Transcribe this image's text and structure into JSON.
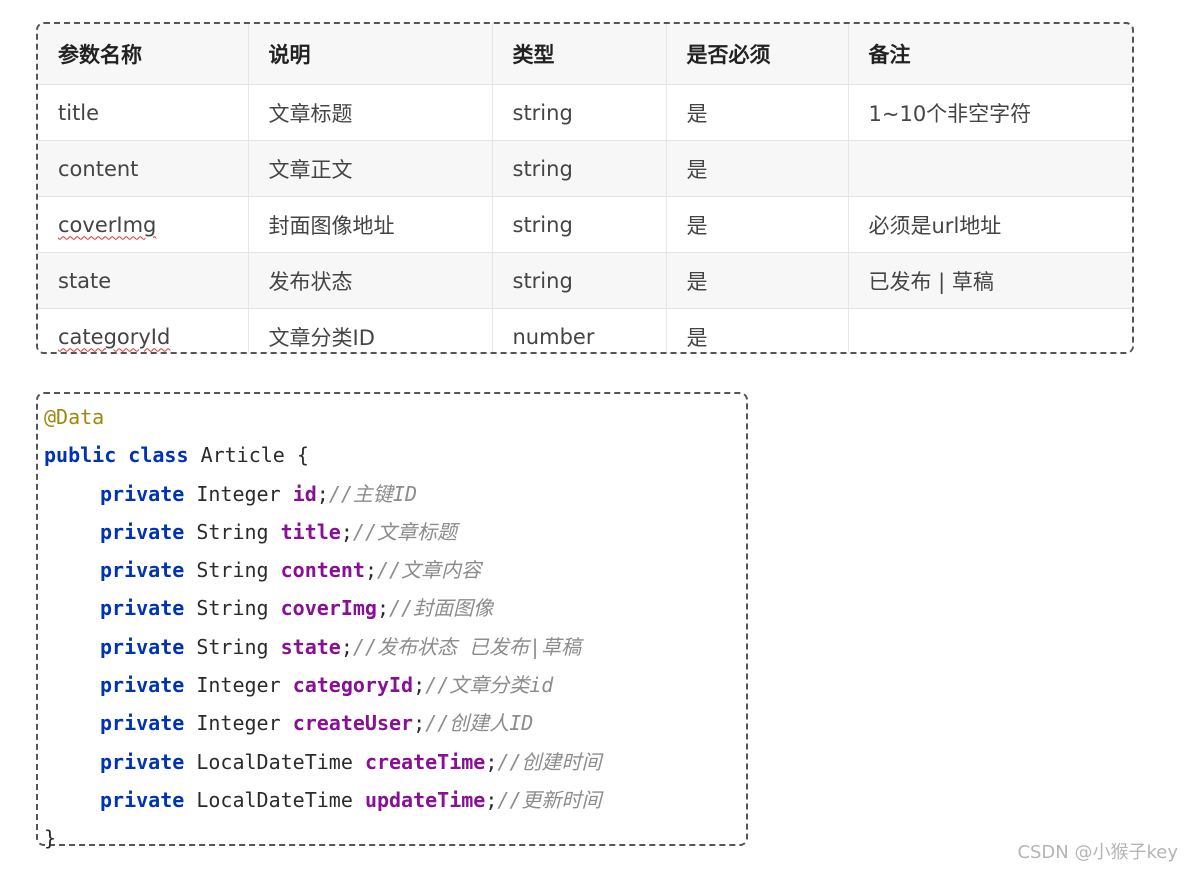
{
  "table": {
    "headers": [
      "参数名称",
      "说明",
      "类型",
      "是否必须",
      "备注"
    ],
    "rows": [
      [
        "title",
        "文章标题",
        "string",
        "是",
        "1~10个非空字符"
      ],
      [
        "content",
        "文章正文",
        "string",
        "是",
        ""
      ],
      [
        "coverImg",
        "封面图像地址",
        "string",
        "是",
        "必须是url地址"
      ],
      [
        "state",
        "发布状态",
        "string",
        "是",
        "已发布 | 草稿"
      ],
      [
        "categoryId",
        "文章分类ID",
        "number",
        "是",
        ""
      ]
    ]
  },
  "code": {
    "annotation": "@Data",
    "kw_public": "public",
    "kw_class": "class",
    "class_name": "Article",
    "open_brace": "{",
    "close_brace": "}",
    "fields": [
      {
        "modifier": "private",
        "type": "Integer",
        "name": "id",
        "comment": "//主键ID"
      },
      {
        "modifier": "private",
        "type": "String",
        "name": "title",
        "comment": "//文章标题"
      },
      {
        "modifier": "private",
        "type": "String",
        "name": "content",
        "comment": "//文章内容"
      },
      {
        "modifier": "private",
        "type": "String",
        "name": "coverImg",
        "comment": "//封面图像"
      },
      {
        "modifier": "private",
        "type": "String",
        "name": "state",
        "comment": "//发布状态 已发布|草稿"
      },
      {
        "modifier": "private",
        "type": "Integer",
        "name": "categoryId",
        "comment": "//文章分类id"
      },
      {
        "modifier": "private",
        "type": "Integer",
        "name": "createUser",
        "comment": "//创建人ID"
      },
      {
        "modifier": "private",
        "type": "LocalDateTime",
        "name": "createTime",
        "comment": "//创建时间"
      },
      {
        "modifier": "private",
        "type": "LocalDateTime",
        "name": "updateTime",
        "comment": "//更新时间"
      }
    ]
  },
  "watermark": "CSDN @小猴子key"
}
